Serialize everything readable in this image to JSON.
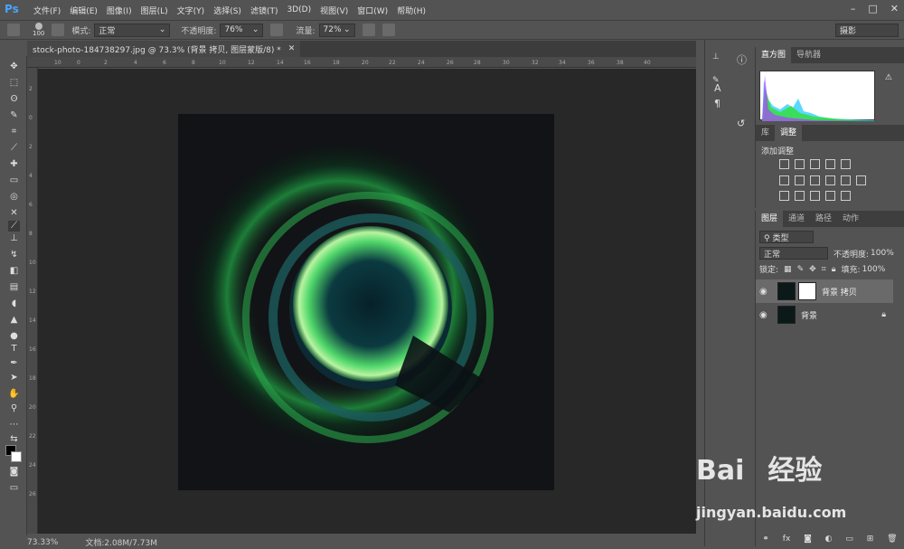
{
  "menubar": {
    "logo": "Ps",
    "items": [
      "文件(F)",
      "编辑(E)",
      "图像(I)",
      "图层(L)",
      "文字(Y)",
      "选择(S)",
      "滤镜(T)",
      "3D(D)",
      "视图(V)",
      "窗口(W)",
      "帮助(H)"
    ]
  },
  "options": {
    "brush_size": "100",
    "mode_label": "模式:",
    "mode_value": "正常",
    "opacity_label": "不透明度:",
    "opacity_value": "76%",
    "flow_label": "流量:",
    "flow_value": "72%",
    "workspace": "摄影"
  },
  "document": {
    "tab_title": "stock-photo-184738297.jpg @ 73.3% (背景 拷贝, 图层蒙版/8) *",
    "zoom": "73.33%",
    "doc_info": "文档:2.08M/7.73M"
  },
  "ruler_top": [
    "10",
    "0",
    "2",
    "4",
    "6",
    "8",
    "10",
    "12",
    "14",
    "16",
    "18",
    "20",
    "22",
    "24",
    "26",
    "28",
    "30",
    "32",
    "34",
    "36",
    "38",
    "40"
  ],
  "ruler_left": [
    "2",
    "0",
    "2",
    "4",
    "6",
    "8",
    "10",
    "12",
    "14",
    "16",
    "18",
    "20",
    "22",
    "24",
    "26"
  ],
  "panels": {
    "histogram_tab": "直方图",
    "navigator_tab": "导航器",
    "library_tab": "库",
    "adjust_tab": "调整",
    "add_adjust": "添加调整",
    "layers_tab": "图层",
    "channels_tab": "通道",
    "paths_tab": "路径",
    "actions_tab": "动作",
    "kind_filter": "类型",
    "blend_mode": "正常",
    "opacity_label": "不透明度:",
    "opacity_value": "100%",
    "lock_label": "锁定:",
    "fill_label": "填充:",
    "fill_value": "100%"
  },
  "layers": [
    {
      "name": "背景 拷贝"
    },
    {
      "name": "背景"
    }
  ],
  "watermark": {
    "text1": "Bai",
    "text2": "经验",
    "url": "jingyan.baidu.com"
  }
}
